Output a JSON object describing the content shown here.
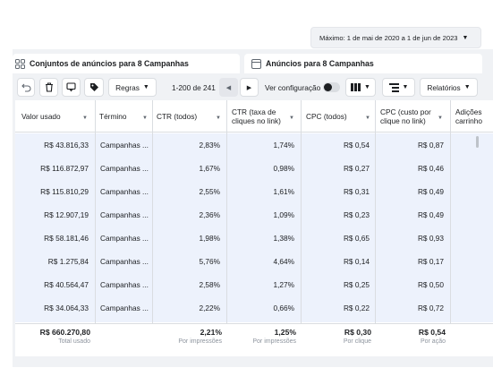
{
  "date_range": {
    "label": "Máximo: 1 de mai de 2020 a 1 de jun de 2023"
  },
  "tabs": [
    {
      "label": "Conjuntos de anúncios para 8 Campanhas",
      "icon": "grid-icon"
    },
    {
      "label": "Anúncios para 8 Campanhas",
      "icon": "ad-square-icon"
    }
  ],
  "toolbar": {
    "rules_label": "Regras",
    "pagination": "1-200 de 241",
    "view_config_label": "Ver configuração",
    "reports_label": "Relatórios"
  },
  "columns": [
    "Valor usado",
    "Término",
    "CTR (todos)",
    "CTR (taxa de cliques no link)",
    "CPC (todos)",
    "CPC (custo por clique no link)",
    "Adições carrinho"
  ],
  "rows": [
    [
      "R$ 43.816,33",
      "Campanhas ...",
      "2,83%",
      "1,74%",
      "R$ 0,54",
      "R$ 0,87"
    ],
    [
      "R$ 116.872,97",
      "Campanhas ...",
      "1,67%",
      "0,98%",
      "R$ 0,27",
      "R$ 0,46"
    ],
    [
      "R$ 115.810,29",
      "Campanhas ...",
      "2,55%",
      "1,61%",
      "R$ 0,31",
      "R$ 0,49"
    ],
    [
      "R$ 12.907,19",
      "Campanhas ...",
      "2,36%",
      "1,09%",
      "R$ 0,23",
      "R$ 0,49"
    ],
    [
      "R$ 58.181,46",
      "Campanhas ...",
      "1,98%",
      "1,38%",
      "R$ 0,65",
      "R$ 0,93"
    ],
    [
      "R$ 1.275,84",
      "Campanhas ...",
      "5,76%",
      "4,64%",
      "R$ 0,14",
      "R$ 0,17"
    ],
    [
      "R$ 40.564,47",
      "Campanhas ...",
      "2,58%",
      "1,27%",
      "R$ 0,25",
      "R$ 0,50"
    ],
    [
      "R$ 34.064,33",
      "Campanhas ...",
      "2,22%",
      "0,66%",
      "R$ 0,22",
      "R$ 0,72"
    ]
  ],
  "totals": [
    {
      "value": "R$ 660.270,80",
      "label": "Total usado"
    },
    {
      "value": "",
      "label": ""
    },
    {
      "value": "2,21%",
      "label": "Por impressões"
    },
    {
      "value": "1,25%",
      "label": "Por impressões"
    },
    {
      "value": "R$ 0,30",
      "label": "Por clique"
    },
    {
      "value": "R$ 0,54",
      "label": "Por ação"
    }
  ]
}
